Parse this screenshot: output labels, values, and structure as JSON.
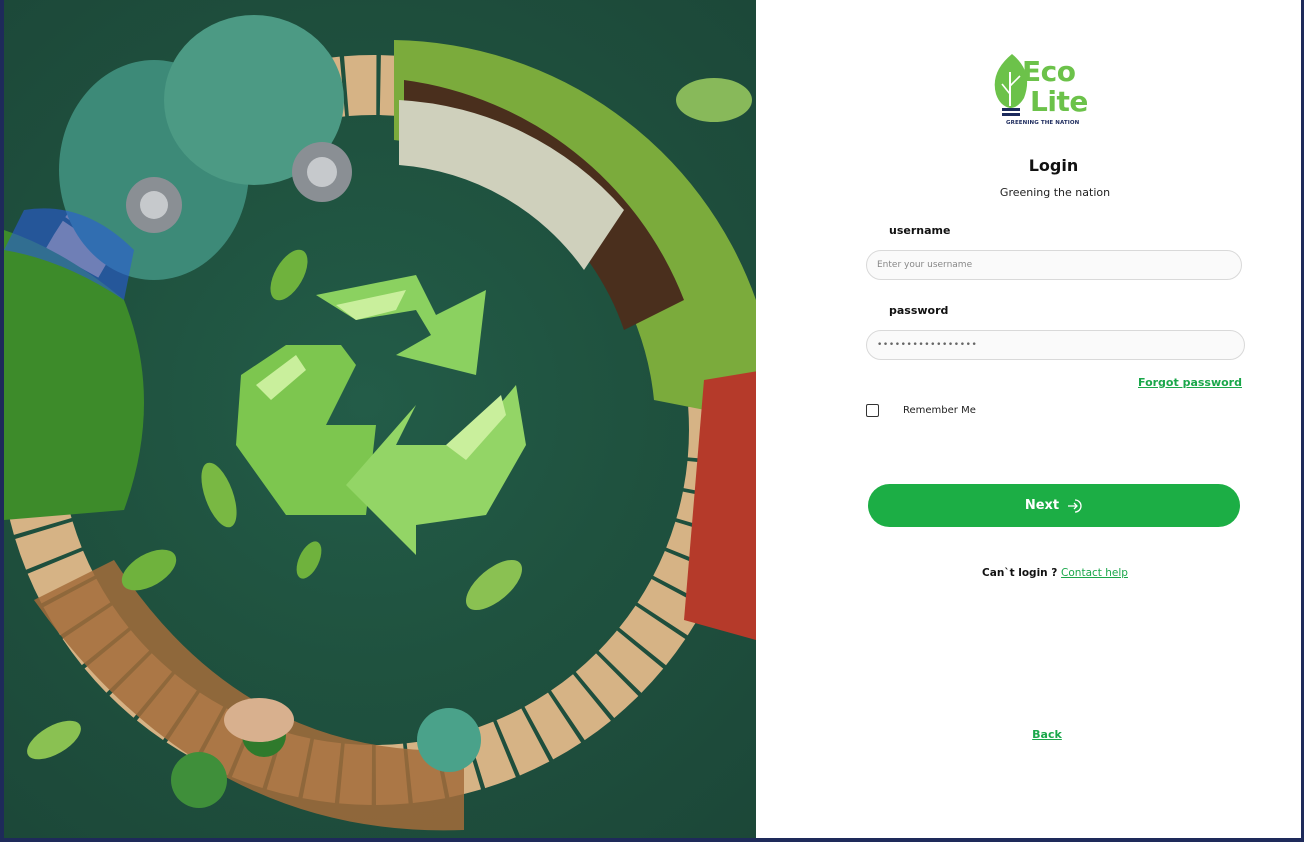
{
  "brand": {
    "name_line1": "Eco",
    "name_line2": "Lite",
    "tagline": "GREENING THE NATION"
  },
  "login": {
    "title": "Login",
    "subtitle": "Greening the nation",
    "username_label": "username",
    "username_placeholder": "Enter your username",
    "password_label": "password",
    "password_value": "•••••••••••••••••",
    "forgot_label": "Forgot password",
    "remember_label": "Remember Me",
    "next_label": "Next",
    "help_prefix": "Can`t login ?",
    "help_link": "Contact help",
    "back_label": "Back"
  },
  "colors": {
    "primary": "#1cae45",
    "logo_green": "#6cc24a",
    "logo_navy": "#1c2a5c",
    "frame": "#1e2a5a"
  },
  "icons": {
    "next": "login-arrow-icon",
    "hero": "recycle-icon"
  }
}
